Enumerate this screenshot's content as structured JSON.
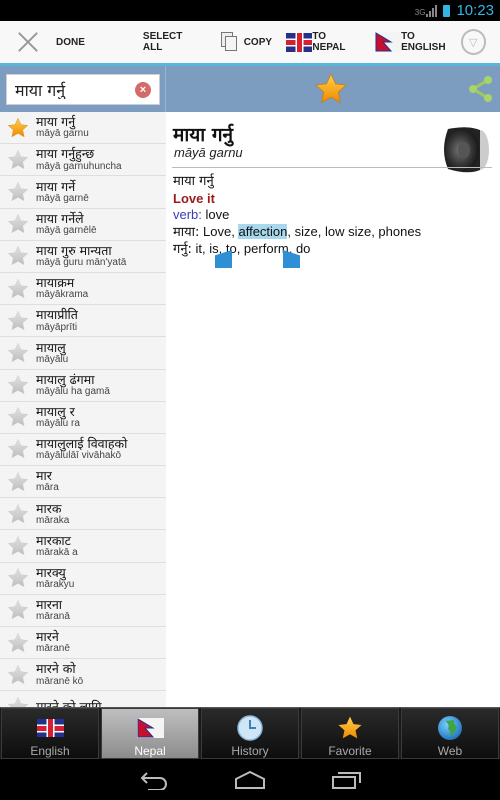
{
  "status_bar": {
    "network": "3G",
    "time": "10:23"
  },
  "action_bar": {
    "done": "DONE",
    "select_all": "SELECT ALL",
    "copy": "COPY",
    "to_nepal": "TO NEPAL",
    "to_english": "TO ENGLISH"
  },
  "search": {
    "value": "माया गर्नु",
    "placeholder": ""
  },
  "word_list": [
    {
      "nepali": "माया गर्नु",
      "roman": "māyā garnu",
      "favorite": true
    },
    {
      "nepali": "माया गर्नुहुन्छ",
      "roman": "māyā garnuhuncha",
      "favorite": false
    },
    {
      "nepali": "माया गर्ने",
      "roman": "māyā garnē",
      "favorite": false
    },
    {
      "nepali": "माया गर्नेले",
      "roman": "māyā garnēlē",
      "favorite": false
    },
    {
      "nepali": "माया गुरु मान्यता",
      "roman": "māyā guru mān'yatā",
      "favorite": false
    },
    {
      "nepali": "मायाक्रम",
      "roman": "māyākrama",
      "favorite": false
    },
    {
      "nepali": "मायाप्रीति",
      "roman": "māyāprīti",
      "favorite": false
    },
    {
      "nepali": "मायालु",
      "roman": "māyālu",
      "favorite": false
    },
    {
      "nepali": "मायालु ढंगमा",
      "roman": "māyālu  ha gamā",
      "favorite": false
    },
    {
      "nepali": "मायालु र",
      "roman": "māyālu ra",
      "favorite": false
    },
    {
      "nepali": "मायालुलाई विवाहको",
      "roman": "māyālulāī vivāhakō",
      "favorite": false
    },
    {
      "nepali": "मार",
      "roman": "māra",
      "favorite": false
    },
    {
      "nepali": "मारक",
      "roman": "māraka",
      "favorite": false
    },
    {
      "nepali": "मारकाट",
      "roman": "mārakā a",
      "favorite": false
    },
    {
      "nepali": "मारक्यु",
      "roman": "mārakyu",
      "favorite": false
    },
    {
      "nepali": "मारना",
      "roman": "māranā",
      "favorite": false
    },
    {
      "nepali": "मारने",
      "roman": "māranē",
      "favorite": false
    },
    {
      "nepali": "मारने को",
      "roman": "māranē kō",
      "favorite": false
    },
    {
      "nepali": "मारने को लागि",
      "roman": "",
      "favorite": false
    }
  ],
  "entry": {
    "title": "माया गर्नु",
    "roman": "māyā garnu",
    "headword": "माया गर्नु",
    "translation": "Love it",
    "pos_label": "verb:",
    "pos_value": " love",
    "line1_label": "माया:",
    "line1_pre": " Love, ",
    "line1_selected": "affection",
    "line1_post": ", size, low size, phones",
    "line2_label": "गर्नु:",
    "line2_text": " it, is, to, perform, do"
  },
  "tabs": [
    {
      "label": "English",
      "icon": "uk-flag-icon",
      "active": false
    },
    {
      "label": "Nepal",
      "icon": "nepal-flag-icon",
      "active": true
    },
    {
      "label": "History",
      "icon": "clock-icon",
      "active": false
    },
    {
      "label": "Favorite",
      "icon": "star-icon",
      "active": false
    },
    {
      "label": "Web",
      "icon": "globe-icon",
      "active": false
    }
  ],
  "colors": {
    "accent": "#33b5e5",
    "panel_header": "#7d9dc0",
    "translation": "#9b1c1c",
    "pos": "#3a3ab8",
    "selection": "#a8d8ee"
  }
}
